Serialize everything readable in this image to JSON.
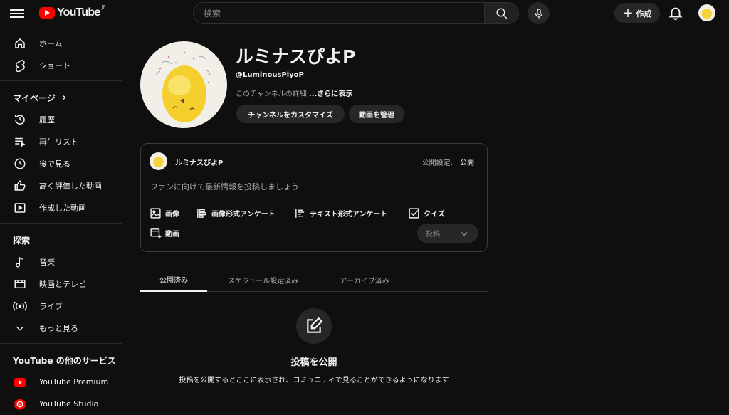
{
  "header": {
    "logo_text": "YouTube",
    "logo_country": "JP",
    "search_placeholder": "検索",
    "create_label": "作成"
  },
  "sidebar": {
    "main_items": [
      {
        "label": "ホーム",
        "icon": "home-icon"
      },
      {
        "label": "ショート",
        "icon": "shorts-icon"
      }
    ],
    "mypage_title": "マイページ",
    "mypage_items": [
      {
        "label": "履歴",
        "icon": "history-icon"
      },
      {
        "label": "再生リスト",
        "icon": "playlist-icon"
      },
      {
        "label": "後で見る",
        "icon": "watch-later-icon"
      },
      {
        "label": "高く評価した動画",
        "icon": "like-icon"
      },
      {
        "label": "作成した動画",
        "icon": "your-videos-icon"
      }
    ],
    "explore_title": "探索",
    "explore_items": [
      {
        "label": "音楽",
        "icon": "music-icon"
      },
      {
        "label": "映画とテレビ",
        "icon": "movies-icon"
      },
      {
        "label": "ライブ",
        "icon": "live-icon"
      },
      {
        "label": "もっと見る",
        "icon": "chevron-down-icon"
      }
    ],
    "services_title": "YouTube の他のサービス",
    "services_items": [
      {
        "label": "YouTube Premium",
        "icon": "youtube-premium-icon"
      },
      {
        "label": "YouTube Studio",
        "icon": "youtube-studio-icon"
      }
    ]
  },
  "channel": {
    "name": "ルミナスぴよP",
    "handle": "@LuminousPiyoP",
    "description": "このチャンネルの詳細",
    "more_label": "...さらに表示",
    "customize_button": "チャンネルをカスタマイズ",
    "manage_button": "動画を管理"
  },
  "post_box": {
    "author": "ルミナスぴよP",
    "visibility_label": "公開設定:",
    "visibility_value": "公開",
    "placeholder": "ファンに向けて最新情報を投稿しましょう",
    "tools": [
      {
        "label": "画像",
        "icon": "image-icon"
      },
      {
        "label": "画像形式アンケート",
        "icon": "image-poll-icon"
      },
      {
        "label": "テキスト形式アンケート",
        "icon": "text-poll-icon"
      },
      {
        "label": "クイズ",
        "icon": "quiz-icon"
      },
      {
        "label": "動画",
        "icon": "video-icon"
      }
    ],
    "submit_label": "投稿"
  },
  "tabs": [
    {
      "label": "公開済み",
      "active": true
    },
    {
      "label": "スケジュール設定済み",
      "active": false
    },
    {
      "label": "アーカイブ済み",
      "active": false
    }
  ],
  "empty_state": {
    "title": "投稿を公開",
    "subtitle": "投稿を公開するとここに表示され、コミュニティで見ることができるようになります"
  },
  "colors": {
    "background": "#0f0f0f",
    "surface": "#272727",
    "brand_red": "#ff0000",
    "text": "#f1f1f1",
    "secondary_text": "#aaaaaa"
  }
}
